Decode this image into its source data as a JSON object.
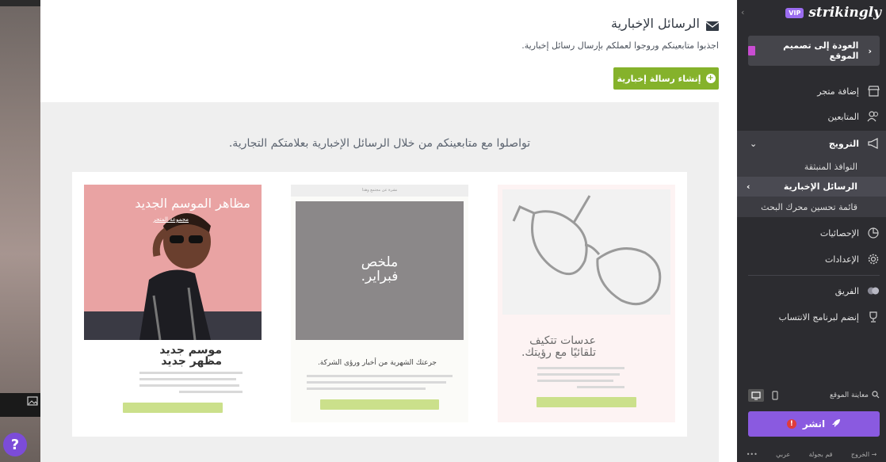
{
  "modal": {
    "title": "الرسائل الإخبارية",
    "subtitle": "اجذبوا متابعينكم وروجوا لعملكم بإرسال رسائل إخبارية.",
    "create_button": "إنشاء رسالة إخبارية",
    "gallery_heading": "تواصلوا مع متابعينكم من خلال الرسائل الإخبارية بعلامتكم التجارية."
  },
  "templates": {
    "fashion": {
      "title": "مظاهر الموسم الجديد",
      "link": "مجموعة المتجر",
      "heading": "موسم جديد\nمظهر جديد"
    },
    "monthly": {
      "top_bar": "نشرة عن مجتمع وهذا",
      "title": "ملخص فبراير.",
      "heading": "جرعتك الشهرية من أخبار ورؤى الشركة."
    },
    "glasses": {
      "heading": "عدسات تتكيف تلقائيًا مع رؤيتك."
    }
  },
  "sidebar": {
    "brand_badge": "VIP",
    "brand_name": "strikingly",
    "back_button": "العودة إلى تصميم الموقع",
    "items": {
      "store": "إضافة متجر",
      "followers": "المتابعين",
      "promote": "الترويج",
      "popups": "النوافذ المنبثقة",
      "newsletters": "الرسائل الإخبارية",
      "seo": "قائمة تحسين محرك البحث",
      "stats": "الإحصائيات",
      "settings": "الإعدادات",
      "team": "الفريق",
      "affiliate": "إنضم لبرنامج الانتساب"
    },
    "preview_label": "معاينة الموقع",
    "publish_button": "انشر",
    "alert_mark": "!",
    "footer": {
      "more": "•••",
      "language": "عربي",
      "tour": "قم بجولة",
      "logout": "الخروج"
    }
  },
  "help": "?"
}
